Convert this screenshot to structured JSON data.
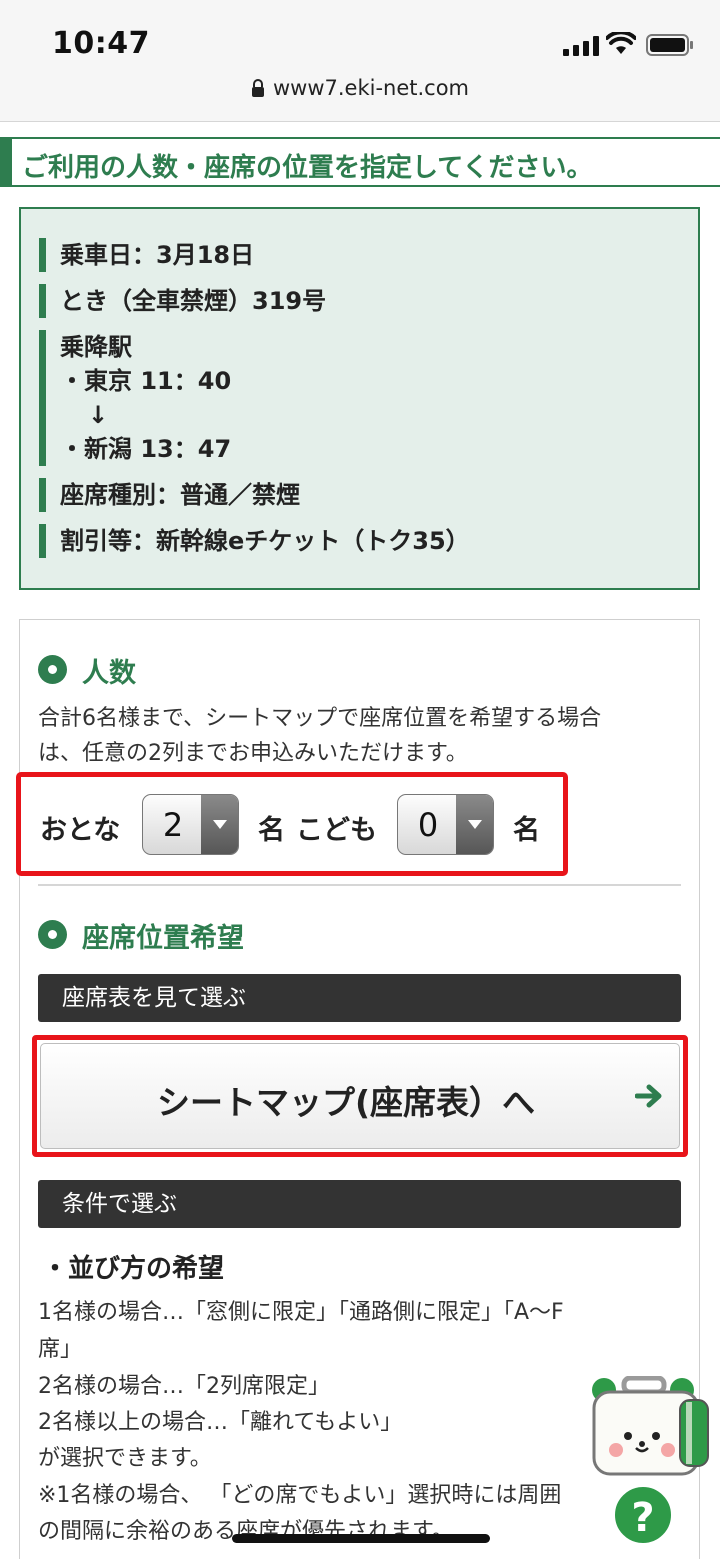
{
  "status_bar": {
    "time": "10:47",
    "url": "www7.eki-net.com"
  },
  "page": {
    "heading": "ご利用の人数・座席の位置を指定してください。"
  },
  "journey": {
    "date": "乗車日：3月18日",
    "train": "とき（全車禁煙）319号",
    "stations_label": "乗降駅",
    "departure": "・東京 11：40",
    "arrow": "↓",
    "arrival": "・新潟 13：47",
    "seat_type": "座席種別：普通／禁煙",
    "discount": "割引等：新幹線eチケット（トク35）"
  },
  "passengers": {
    "title": "人数",
    "desc_line1": "合計6名様まで、シートマップで座席位置を希望する場合",
    "desc_line2": "は、任意の2列までお申込みいただけます。",
    "adult_label": "おとな",
    "adult_value": "2",
    "adult_unit": "名",
    "child_label": "こども",
    "child_value": "0",
    "child_unit": "名"
  },
  "seat_position": {
    "title": "座席位置希望",
    "map_bar": "座席表を見て選ぶ",
    "map_button": "シートマップ(座席表）へ",
    "condition_bar": "条件で選ぶ",
    "arrangement_title": "・並び方の希望",
    "lines": [
      "1名様の場合…「窓側に限定」「通路側に限定」「A〜F",
      "席」",
      "2名様の場合…「2列席限定」",
      "2名様以上の場合…「離れてもよい」",
      "が選択できます。",
      "※1名様の場合、 「どの席でもよい」選択時には周囲",
      "の間隔に余裕のある座席が優先されます。"
    ]
  },
  "help": {
    "label": "?"
  },
  "colors": {
    "brand_green": "#2e7d4f",
    "highlight_red": "#e8141a",
    "dark_bar": "#333333",
    "info_bg": "#e4efea"
  }
}
